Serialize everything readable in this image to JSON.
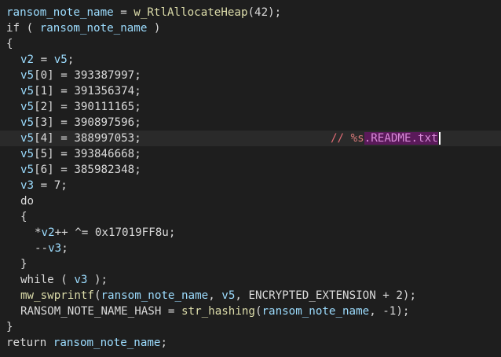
{
  "lines": [
    {
      "indent": 0,
      "tokens": [
        {
          "t": "var",
          "v": "ransom_note_name"
        },
        {
          "t": "txt",
          "v": " = "
        },
        {
          "t": "glb",
          "v": "w_RtlAllocateHeap"
        },
        {
          "t": "txt",
          "v": "(42);"
        }
      ]
    },
    {
      "indent": 0,
      "tokens": [
        {
          "t": "txt",
          "v": "if ( "
        },
        {
          "t": "var",
          "v": "ransom_note_name"
        },
        {
          "t": "txt",
          "v": " )"
        }
      ]
    },
    {
      "indent": 0,
      "tokens": [
        {
          "t": "txt",
          "v": "{"
        }
      ]
    },
    {
      "indent": 1,
      "tokens": [
        {
          "t": "var",
          "v": "v2"
        },
        {
          "t": "txt",
          "v": " = "
        },
        {
          "t": "var",
          "v": "v5"
        },
        {
          "t": "txt",
          "v": ";"
        }
      ]
    },
    {
      "indent": 1,
      "tokens": [
        {
          "t": "var",
          "v": "v5"
        },
        {
          "t": "txt",
          "v": "[0] = 393387997;"
        }
      ]
    },
    {
      "indent": 1,
      "tokens": [
        {
          "t": "var",
          "v": "v5"
        },
        {
          "t": "txt",
          "v": "[1] = 391356374;"
        }
      ]
    },
    {
      "indent": 1,
      "tokens": [
        {
          "t": "var",
          "v": "v5"
        },
        {
          "t": "txt",
          "v": "[2] = 390111165;"
        }
      ]
    },
    {
      "indent": 1,
      "tokens": [
        {
          "t": "var",
          "v": "v5"
        },
        {
          "t": "txt",
          "v": "[3] = 390897596;"
        }
      ]
    },
    {
      "indent": 1,
      "current": true,
      "tokens": [
        {
          "t": "var",
          "v": "v5"
        },
        {
          "t": "txt",
          "v": "[4] = 388997053;"
        }
      ],
      "comment": {
        "prefix": "// ",
        "fmt": "%s",
        "highlight": ".README.txt"
      }
    },
    {
      "indent": 1,
      "tokens": [
        {
          "t": "var",
          "v": "v5"
        },
        {
          "t": "txt",
          "v": "[5] = 393846668;"
        }
      ]
    },
    {
      "indent": 1,
      "tokens": [
        {
          "t": "var",
          "v": "v5"
        },
        {
          "t": "txt",
          "v": "[6] = 385982348;"
        }
      ]
    },
    {
      "indent": 1,
      "tokens": [
        {
          "t": "var",
          "v": "v3"
        },
        {
          "t": "txt",
          "v": " = 7;"
        }
      ]
    },
    {
      "indent": 1,
      "tokens": [
        {
          "t": "txt",
          "v": "do"
        }
      ]
    },
    {
      "indent": 1,
      "tokens": [
        {
          "t": "txt",
          "v": "{"
        }
      ]
    },
    {
      "indent": 2,
      "tokens": [
        {
          "t": "txt",
          "v": "*"
        },
        {
          "t": "var",
          "v": "v2"
        },
        {
          "t": "txt",
          "v": "++ ^= 0x17019FF8u;"
        }
      ]
    },
    {
      "indent": 2,
      "tokens": [
        {
          "t": "txt",
          "v": "--"
        },
        {
          "t": "var",
          "v": "v3"
        },
        {
          "t": "txt",
          "v": ";"
        }
      ]
    },
    {
      "indent": 1,
      "tokens": [
        {
          "t": "txt",
          "v": "}"
        }
      ]
    },
    {
      "indent": 1,
      "tokens": [
        {
          "t": "txt",
          "v": "while ( "
        },
        {
          "t": "var",
          "v": "v3"
        },
        {
          "t": "txt",
          "v": " );"
        }
      ]
    },
    {
      "indent": 1,
      "tokens": [
        {
          "t": "glb",
          "v": "mw_swprintf"
        },
        {
          "t": "txt",
          "v": "("
        },
        {
          "t": "var",
          "v": "ransom_note_name"
        },
        {
          "t": "txt",
          "v": ", "
        },
        {
          "t": "var",
          "v": "v5"
        },
        {
          "t": "txt",
          "v": ", ENCRYPTED_EXTENSION + 2);"
        }
      ]
    },
    {
      "indent": 1,
      "tokens": [
        {
          "t": "txt",
          "v": "RANSOM_NOTE_NAME_HASH = "
        },
        {
          "t": "glb",
          "v": "str_hashing"
        },
        {
          "t": "txt",
          "v": "("
        },
        {
          "t": "var",
          "v": "ransom_note_name"
        },
        {
          "t": "txt",
          "v": ", -1);"
        }
      ]
    },
    {
      "indent": 0,
      "tokens": [
        {
          "t": "txt",
          "v": "}"
        }
      ]
    },
    {
      "indent": 0,
      "tokens": [
        {
          "t": "txt",
          "v": "return "
        },
        {
          "t": "var",
          "v": "ransom_note_name"
        },
        {
          "t": "txt",
          "v": ";"
        }
      ]
    }
  ],
  "colors": {
    "background": "#1e1e1e",
    "text": "#dadada",
    "variable": "#9cdcfe",
    "function": "#dcdcaa",
    "comment": "#e06c75",
    "highlight_bg": "#5a1a5a"
  }
}
